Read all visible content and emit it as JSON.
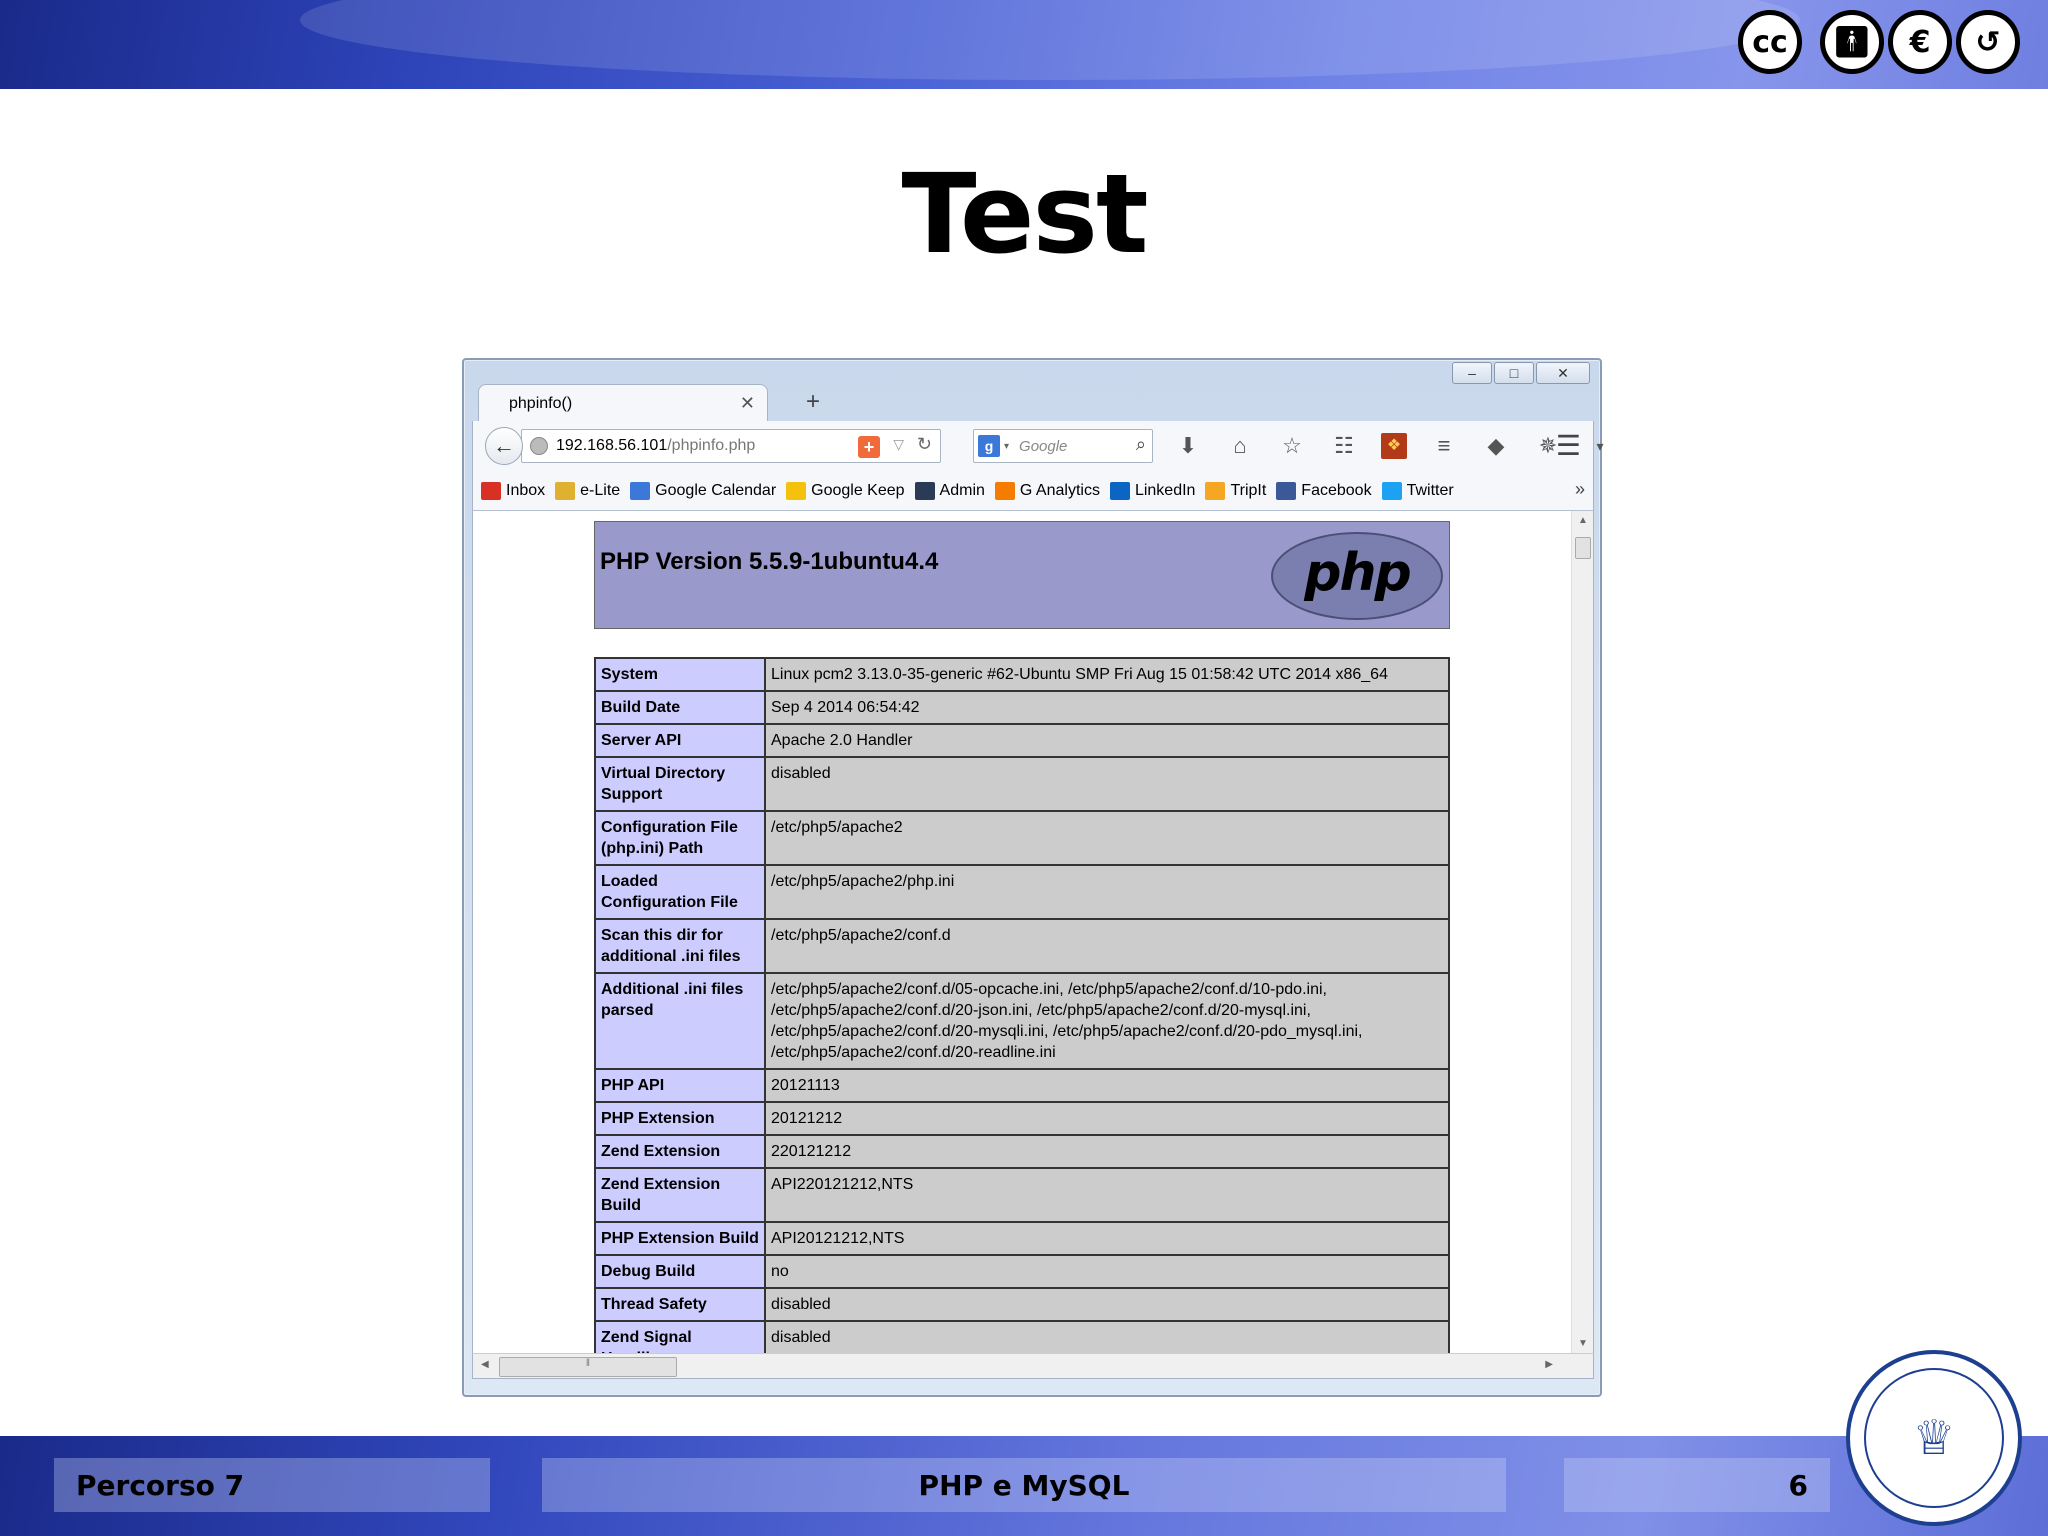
{
  "slide": {
    "title": "Test",
    "cc_badges": [
      "cc",
      "by",
      "nc",
      "sa"
    ],
    "footer": {
      "left": "Percorso 7",
      "center": "PHP e MySQL",
      "right": "6"
    },
    "seal_icon": "politecnico-di-torino-seal"
  },
  "browser": {
    "tab_title": "phpinfo()",
    "url_host": "192.168.56.101",
    "url_path": "/phpinfo.php",
    "search_placeholder": "Google",
    "bookmarks": [
      {
        "label": "Inbox",
        "icon": "gmail-icon",
        "color": "#d93025"
      },
      {
        "label": "e-Lite",
        "icon": "elite-icon",
        "color": "#e0b030"
      },
      {
        "label": "Google Calendar",
        "icon": "calendar-icon",
        "color": "#3c78d8"
      },
      {
        "label": "Google Keep",
        "icon": "keep-icon",
        "color": "#f4c20d"
      },
      {
        "label": "Admin",
        "icon": "admin-icon",
        "color": "#2b3b55"
      },
      {
        "label": "G Analytics",
        "icon": "analytics-icon",
        "color": "#f57c00"
      },
      {
        "label": "LinkedIn",
        "icon": "linkedin-icon",
        "color": "#0a66c2"
      },
      {
        "label": "TripIt",
        "icon": "tripit-icon",
        "color": "#f5a623"
      },
      {
        "label": "Facebook",
        "icon": "facebook-icon",
        "color": "#3b5998"
      },
      {
        "label": "Twitter",
        "icon": "twitter-icon",
        "color": "#1da1f2"
      }
    ]
  },
  "phpinfo": {
    "version": "PHP Version 5.5.9-1ubuntu4.4",
    "logo": "php",
    "rows": [
      {
        "key": "System",
        "value": "Linux pcm2 3.13.0-35-generic #62-Ubuntu SMP Fri Aug 15 01:58:42 UTC 2014 x86_64"
      },
      {
        "key": "Build Date",
        "value": "Sep 4 2014 06:54:42"
      },
      {
        "key": "Server API",
        "value": "Apache 2.0 Handler"
      },
      {
        "key": "Virtual Directory Support",
        "value": "disabled"
      },
      {
        "key": "Configuration File (php.ini) Path",
        "value": "/etc/php5/apache2"
      },
      {
        "key": "Loaded Configuration File",
        "value": "/etc/php5/apache2/php.ini"
      },
      {
        "key": "Scan this dir for additional .ini files",
        "value": "/etc/php5/apache2/conf.d"
      },
      {
        "key": "Additional .ini files parsed",
        "value": "/etc/php5/apache2/conf.d/05-opcache.ini, /etc/php5/apache2/conf.d/10-pdo.ini, /etc/php5/apache2/conf.d/20-json.ini, /etc/php5/apache2/conf.d/20-mysql.ini, /etc/php5/apache2/conf.d/20-mysqli.ini, /etc/php5/apache2/conf.d/20-pdo_mysql.ini, /etc/php5/apache2/conf.d/20-readline.ini"
      },
      {
        "key": "PHP API",
        "value": "20121113"
      },
      {
        "key": "PHP Extension",
        "value": "20121212"
      },
      {
        "key": "Zend Extension",
        "value": "220121212"
      },
      {
        "key": "Zend Extension Build",
        "value": "API220121212,NTS"
      },
      {
        "key": "PHP Extension Build",
        "value": "API20121212,NTS"
      },
      {
        "key": "Debug Build",
        "value": "no"
      },
      {
        "key": "Thread Safety",
        "value": "disabled"
      },
      {
        "key": "Zend Signal Handling",
        "value": "disabled"
      }
    ]
  }
}
